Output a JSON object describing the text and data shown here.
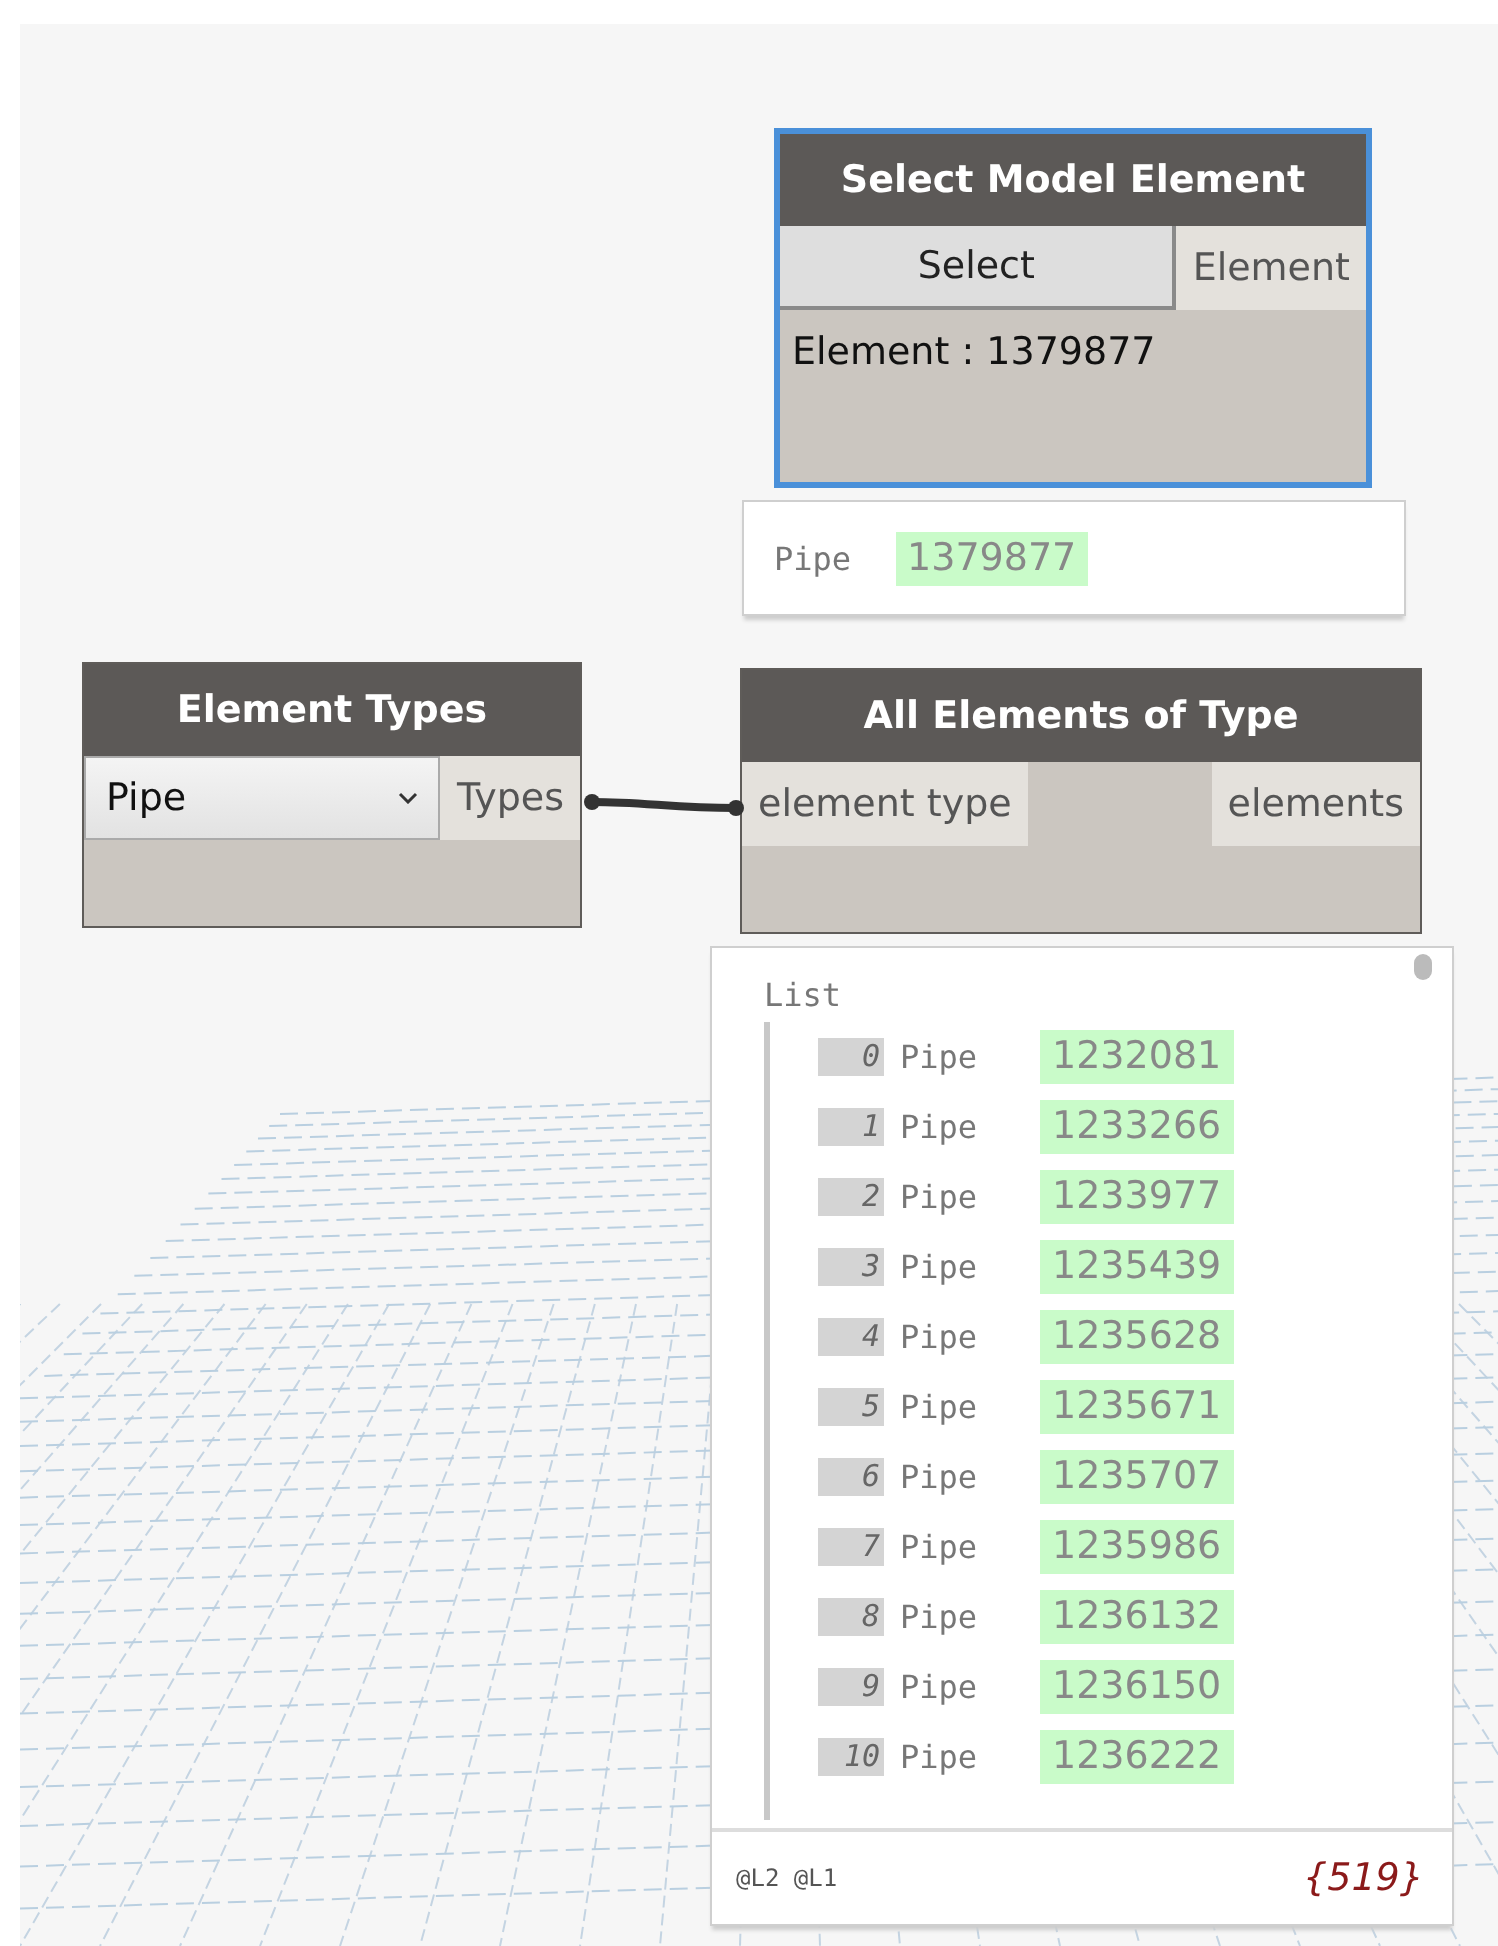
{
  "nodes": [
    {
      "kind": "select",
      "title": "Select Model Element",
      "selected": true,
      "button": "Select",
      "outputs": [
        "Element"
      ],
      "value_text": "Element : 1379877",
      "preview": {
        "kind": "single",
        "type": "Pipe",
        "id": "1379877"
      }
    },
    {
      "kind": "dropdown",
      "title": "Element Types",
      "selected": false,
      "dropdown": "Pipe",
      "outputs": [
        "Types"
      ]
    },
    {
      "kind": "function",
      "title": "All Elements of Type",
      "selected": false,
      "inputs": [
        "element type"
      ],
      "outputs": [
        "elements"
      ],
      "preview": {
        "kind": "list",
        "label": "List",
        "items": [
          {
            "index": "0",
            "type": "Pipe",
            "id": "1232081"
          },
          {
            "index": "1",
            "type": "Pipe",
            "id": "1233266"
          },
          {
            "index": "2",
            "type": "Pipe",
            "id": "1233977"
          },
          {
            "index": "3",
            "type": "Pipe",
            "id": "1235439"
          },
          {
            "index": "4",
            "type": "Pipe",
            "id": "1235628"
          },
          {
            "index": "5",
            "type": "Pipe",
            "id": "1235671"
          },
          {
            "index": "6",
            "type": "Pipe",
            "id": "1235707"
          },
          {
            "index": "7",
            "type": "Pipe",
            "id": "1235986"
          },
          {
            "index": "8",
            "type": "Pipe",
            "id": "1236132"
          },
          {
            "index": "9",
            "type": "Pipe",
            "id": "1236150"
          },
          {
            "index": "10",
            "type": "Pipe",
            "id": "1236222"
          }
        ],
        "levels": "@L2 @L1",
        "count": "{519}"
      }
    }
  ]
}
